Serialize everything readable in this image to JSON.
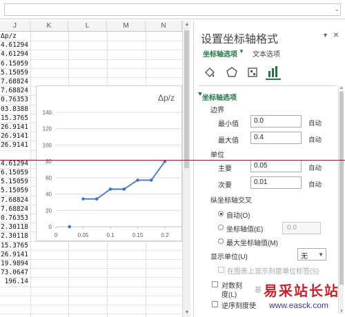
{
  "sheet": {
    "columns": [
      "J",
      "K",
      "L",
      "M",
      "N"
    ],
    "cells": [
      "Δp/z",
      "4.61294",
      "4.61294",
      "6.15059",
      "5.15059",
      "7.68824",
      "7.68824",
      "0.76353",
      "03.8388",
      "15.3765",
      "26.9141",
      "26.9141",
      "26.9141",
      "",
      "4.61294",
      "6.15059",
      "5.15059",
      "5.15059",
      "7.68824",
      "7.68824",
      "0.76353",
      "2.30118",
      "2.30118",
      "15.3765",
      "26.9141",
      "19.9894",
      "73.0647",
      "196.14"
    ]
  },
  "chart": {
    "title": "Δp/z",
    "color": "#4472c4"
  },
  "chart_data": {
    "type": "line",
    "title": "Δp/z",
    "x": [
      0.025,
      0.05,
      0.075,
      0.1,
      0.125,
      0.15,
      0.175,
      0.2
    ],
    "values": [
      0,
      34,
      34,
      46,
      46,
      57,
      57,
      80
    ],
    "xlim": [
      0,
      0.2
    ],
    "ylim": [
      0,
      140
    ],
    "xticks": [
      "0",
      "0.05",
      "0.1",
      "0.15",
      "0.2"
    ],
    "yticks": [
      "0",
      "20",
      "40",
      "60",
      "80",
      "100",
      "120",
      "140"
    ],
    "grid": true,
    "color": "#4472c4"
  },
  "pane": {
    "title": "设置坐标轴格式",
    "tab_axis": "坐标轴选项",
    "tab_text": "文本选项",
    "section": "坐标轴选项",
    "bounds_label": "边界",
    "min_label": "最小值",
    "min_value": "0.0",
    "max_label": "最大值",
    "max_value": "0.4",
    "units_label": "单位",
    "major_label": "主要",
    "major_value": "0.05",
    "minor_label": "次要",
    "minor_value": "0.01",
    "auto": "自动",
    "cross_label": "纵坐标轴交叉",
    "cross_auto": "自动(O)",
    "cross_value": "坐标轴值(E)",
    "cross_value_input": "0.0",
    "cross_max": "最大坐标轴值(M)",
    "display_units_label": "显示单位(U)",
    "display_units_value": "无",
    "show_units_label": "在图表上显示刻度单位标签(S)",
    "log_scale_1": "对数刻",
    "log_scale_2": "度(L)",
    "log_base_partial": "基",
    "reverse_label": "逆序刻度使",
    "accent": "#217346"
  },
  "watermark": {
    "text": "易采站长站",
    "url": "www.easck.com"
  }
}
